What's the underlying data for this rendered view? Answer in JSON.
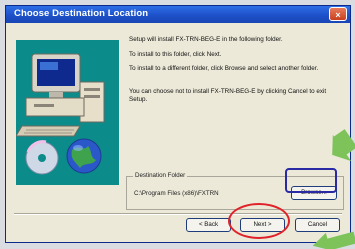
{
  "window": {
    "title": "Choose Destination Location",
    "close_glyph": "×"
  },
  "body": {
    "line1": "Setup will install FX-TRN-BEG-E in the following folder.",
    "line2": "To install to this folder, click Next.",
    "line3": "To install to a different folder, click Browse and select another folder.",
    "line4": "You can choose not to install FX-TRN-BEG-E by clicking Cancel to exit Setup."
  },
  "destination": {
    "group_label": "Destination Folder",
    "path": "C:\\Program Files (x86)\\FXTRN",
    "browse_label": "Browse..."
  },
  "buttons": {
    "back_label": "< Back",
    "next_label": "Next >",
    "cancel_label": "Cancel"
  },
  "annotations": {
    "highlight_color": "#e0232b",
    "browse_box_color": "#2a2aa5",
    "arrow_color": "#7dc35a"
  },
  "icons": [
    "computer-icon",
    "globe-icon",
    "close-icon"
  ]
}
